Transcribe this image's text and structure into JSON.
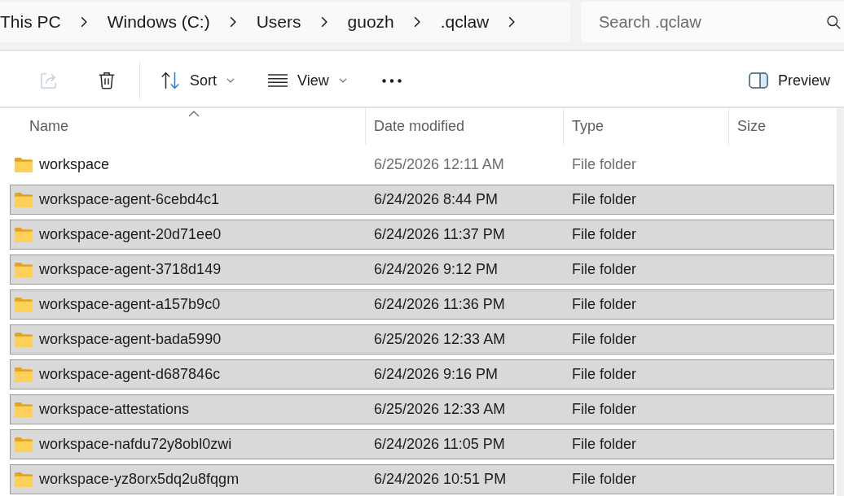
{
  "address_bar": {
    "breadcrumbs": [
      {
        "label": "This PC"
      },
      {
        "label": "Windows (C:)"
      },
      {
        "label": "Users"
      },
      {
        "label": "guozh"
      },
      {
        "label": ".qclaw"
      }
    ]
  },
  "search": {
    "placeholder": "Search .qclaw"
  },
  "toolbar": {
    "share_button": {
      "disabled": true
    },
    "delete_button": {
      "disabled": false
    },
    "sort_button": {
      "label": "Sort"
    },
    "view_button": {
      "label": "View"
    },
    "preview_button": {
      "label": "Preview"
    }
  },
  "table": {
    "columns": [
      {
        "label": "Name",
        "sorted": true
      },
      {
        "label": "Date modified",
        "sorted": false
      },
      {
        "label": "Type",
        "sorted": false
      },
      {
        "label": "Size",
        "sorted": false
      }
    ],
    "rows": [
      {
        "name": "workspace",
        "date_modified": "6/25/2026 12:11 AM",
        "type": "File folder",
        "selected": false
      },
      {
        "name": "workspace-agent-6cebd4c1",
        "date_modified": "6/24/2026 8:44 PM",
        "type": "File folder",
        "selected": true
      },
      {
        "name": "workspace-agent-20d71ee0",
        "date_modified": "6/24/2026 11:37 PM",
        "type": "File folder",
        "selected": true
      },
      {
        "name": "workspace-agent-3718d149",
        "date_modified": "6/24/2026 9:12 PM",
        "type": "File folder",
        "selected": true
      },
      {
        "name": "workspace-agent-a157b9c0",
        "date_modified": "6/24/2026 11:36 PM",
        "type": "File folder",
        "selected": true
      },
      {
        "name": "workspace-agent-bada5990",
        "date_modified": "6/25/2026 12:33 AM",
        "type": "File folder",
        "selected": true
      },
      {
        "name": "workspace-agent-d687846c",
        "date_modified": "6/24/2026 9:16 PM",
        "type": "File folder",
        "selected": true
      },
      {
        "name": "workspace-attestations",
        "date_modified": "6/25/2026 12:33 AM",
        "type": "File folder",
        "selected": true
      },
      {
        "name": "workspace-nafdu72y8obl0zwi",
        "date_modified": "6/24/2026 11:05 PM",
        "type": "File folder",
        "selected": true
      },
      {
        "name": "workspace-yz8orx5dq2u8fqgm",
        "date_modified": "6/24/2026 10:51 PM",
        "type": "File folder",
        "selected": true
      }
    ]
  }
}
